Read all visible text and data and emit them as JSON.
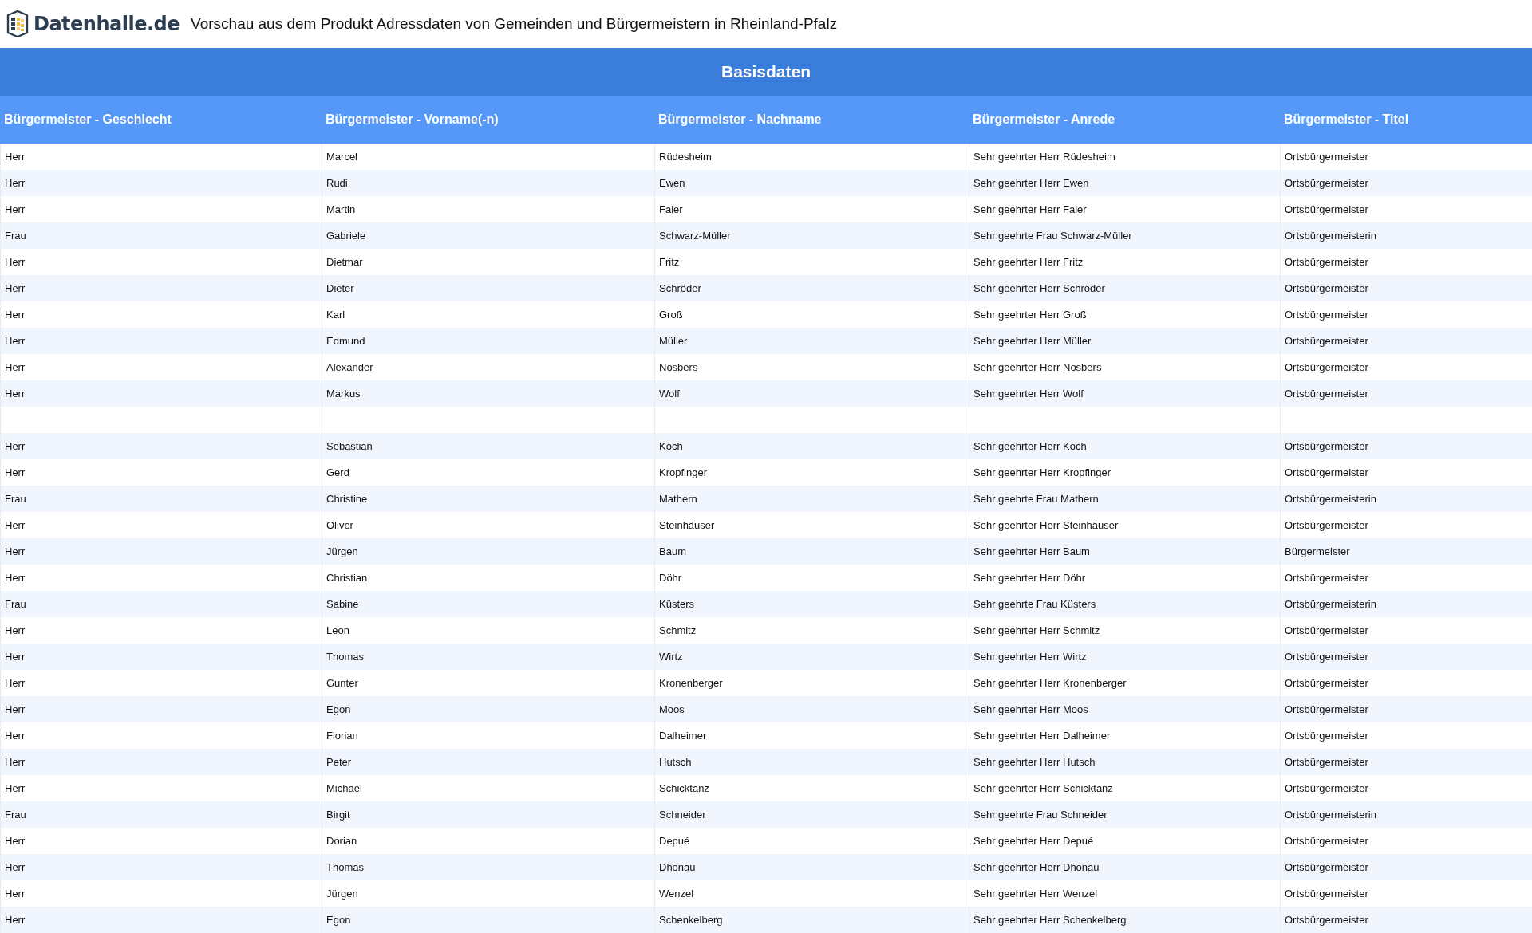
{
  "header": {
    "logo_text": "Datenhalle.de",
    "title": "Vorschau aus dem Produkt Adressdaten von Gemeinden und Bürgermeistern in Rheinland-Pfalz"
  },
  "table": {
    "caption": "Basisdaten",
    "columns": [
      "Bürgermeister - Geschlecht",
      "Bürgermeister - Vorname(-n)",
      "Bürgermeister - Nachname",
      "Bürgermeister - Anrede",
      "Bürgermeister - Titel"
    ],
    "rows": [
      {
        "kind": "data",
        "cells": [
          "Herr",
          "Marcel",
          "Rüdesheim",
          "Sehr geehrter Herr Rüdesheim",
          "Ortsbürgermeister"
        ]
      },
      {
        "kind": "data",
        "cells": [
          "Herr",
          "Rudi",
          "Ewen",
          "Sehr geehrter Herr Ewen",
          "Ortsbürgermeister"
        ]
      },
      {
        "kind": "data",
        "cells": [
          "Herr",
          "Martin",
          "Faier",
          "Sehr geehrter Herr Faier",
          "Ortsbürgermeister"
        ]
      },
      {
        "kind": "data",
        "cells": [
          "Frau",
          "Gabriele",
          "Schwarz-Müller",
          "Sehr geehrte Frau Schwarz-Müller",
          "Ortsbürgermeisterin"
        ]
      },
      {
        "kind": "data",
        "cells": [
          "Herr",
          "Dietmar",
          "Fritz",
          "Sehr geehrter Herr Fritz",
          "Ortsbürgermeister"
        ]
      },
      {
        "kind": "data",
        "cells": [
          "Herr",
          "Dieter",
          "Schröder",
          "Sehr geehrter Herr Schröder",
          "Ortsbürgermeister"
        ]
      },
      {
        "kind": "data",
        "cells": [
          "Herr",
          "Karl",
          "Groß",
          "Sehr geehrter Herr Groß",
          "Ortsbürgermeister"
        ]
      },
      {
        "kind": "data",
        "cells": [
          "Herr",
          "Edmund",
          "Müller",
          "Sehr geehrter Herr Müller",
          "Ortsbürgermeister"
        ]
      },
      {
        "kind": "data",
        "cells": [
          "Herr",
          "Alexander",
          "Nosbers",
          "Sehr geehrter Herr Nosbers",
          "Ortsbürgermeister"
        ]
      },
      {
        "kind": "data",
        "cells": [
          "Herr",
          "Markus",
          "Wolf",
          "Sehr geehrter Herr Wolf",
          "Ortsbürgermeister"
        ]
      },
      {
        "kind": "blank"
      },
      {
        "kind": "data",
        "cells": [
          "Herr",
          "Sebastian",
          "Koch",
          "Sehr geehrter Herr Koch",
          "Ortsbürgermeister"
        ]
      },
      {
        "kind": "data",
        "cells": [
          "Herr",
          "Gerd",
          "Kropfinger",
          "Sehr geehrter Herr Kropfinger",
          "Ortsbürgermeister"
        ]
      },
      {
        "kind": "data",
        "cells": [
          "Frau",
          "Christine",
          "Mathern",
          "Sehr geehrte Frau Mathern",
          "Ortsbürgermeisterin"
        ]
      },
      {
        "kind": "data",
        "cells": [
          "Herr",
          "Oliver",
          "Steinhäuser",
          "Sehr geehrter Herr Steinhäuser",
          "Ortsbürgermeister"
        ]
      },
      {
        "kind": "data",
        "cells": [
          "Herr",
          "Jürgen",
          "Baum",
          "Sehr geehrter Herr Baum",
          "Bürgermeister"
        ]
      },
      {
        "kind": "data",
        "cells": [
          "Herr",
          "Christian",
          "Döhr",
          "Sehr geehrter Herr Döhr",
          "Ortsbürgermeister"
        ]
      },
      {
        "kind": "data",
        "cells": [
          "Frau",
          "Sabine",
          "Küsters",
          "Sehr geehrte Frau Küsters",
          "Ortsbürgermeisterin"
        ]
      },
      {
        "kind": "data",
        "cells": [
          "Herr",
          "Leon",
          "Schmitz",
          "Sehr geehrter Herr Schmitz",
          "Ortsbürgermeister"
        ]
      },
      {
        "kind": "data",
        "cells": [
          "Herr",
          "Thomas",
          "Wirtz",
          "Sehr geehrter Herr Wirtz",
          "Ortsbürgermeister"
        ]
      },
      {
        "kind": "data",
        "cells": [
          "Herr",
          "Gunter",
          "Kronenberger",
          "Sehr geehrter Herr Kronenberger",
          "Ortsbürgermeister"
        ]
      },
      {
        "kind": "data",
        "cells": [
          "Herr",
          "Egon",
          "Moos",
          "Sehr geehrter Herr Moos",
          "Ortsbürgermeister"
        ]
      },
      {
        "kind": "data",
        "cells": [
          "Herr",
          "Florian",
          "Dalheimer",
          "Sehr geehrter Herr Dalheimer",
          "Ortsbürgermeister"
        ]
      },
      {
        "kind": "data",
        "cells": [
          "Herr",
          "Peter",
          "Hutsch",
          "Sehr geehrter Herr Hutsch",
          "Ortsbürgermeister"
        ]
      },
      {
        "kind": "data",
        "cells": [
          "Herr",
          "Michael",
          "Schicktanz",
          "Sehr geehrter Herr Schicktanz",
          "Ortsbürgermeister"
        ]
      },
      {
        "kind": "data",
        "cells": [
          "Frau",
          "Birgit",
          "Schneider",
          "Sehr geehrte Frau Schneider",
          "Ortsbürgermeisterin"
        ]
      },
      {
        "kind": "data",
        "cells": [
          "Herr",
          "Dorian",
          "Depué",
          "Sehr geehrter Herr Depué",
          "Ortsbürgermeister"
        ]
      },
      {
        "kind": "data",
        "cells": [
          "Herr",
          "Thomas",
          "Dhonau",
          "Sehr geehrter Herr Dhonau",
          "Ortsbürgermeister"
        ]
      },
      {
        "kind": "data",
        "cells": [
          "Herr",
          "Jürgen",
          "Wenzel",
          "Sehr geehrter Herr Wenzel",
          "Ortsbürgermeister"
        ]
      },
      {
        "kind": "data",
        "cells": [
          "Herr",
          "Egon",
          "Schenkelberg",
          "Sehr geehrter Herr Schenkelberg",
          "Ortsbürgermeister"
        ]
      }
    ]
  }
}
